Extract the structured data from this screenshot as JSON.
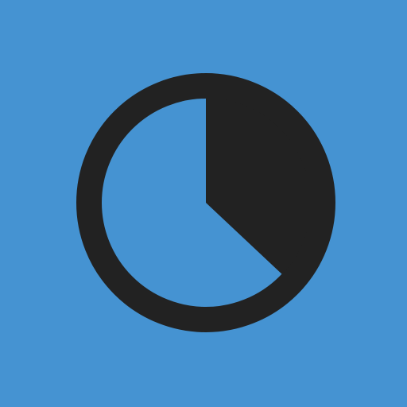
{
  "colors": {
    "background": "#4593D2",
    "foreground": "#222222"
  },
  "icon": {
    "name": "pie-timer-icon",
    "progress_fraction": 0.37
  }
}
